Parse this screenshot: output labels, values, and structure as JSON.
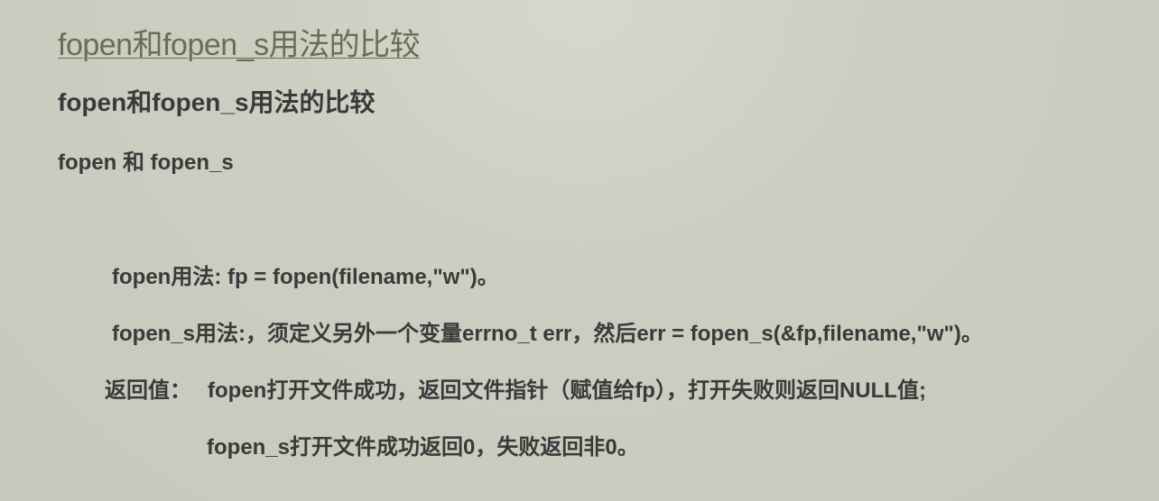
{
  "article": {
    "link_title": "fopen和fopen_s用法的比较",
    "heading": "fopen和fopen_s用法的比较",
    "subheading": "fopen 和 fopen_s",
    "usage_fopen": "fopen用法: fp = fopen(filename,\"w\")。",
    "usage_fopen_s": "fopen_s用法:，须定义另外一个变量errno_t err，然后err = fopen_s(&fp,filename,\"w\")。",
    "return_label": "返回值：",
    "return_fopen": "fopen打开文件成功，返回文件指针（赋值给fp），打开失败则返回NULL值;",
    "return_fopen_s": "fopen_s打开文件成功返回0，失败返回非0。"
  }
}
